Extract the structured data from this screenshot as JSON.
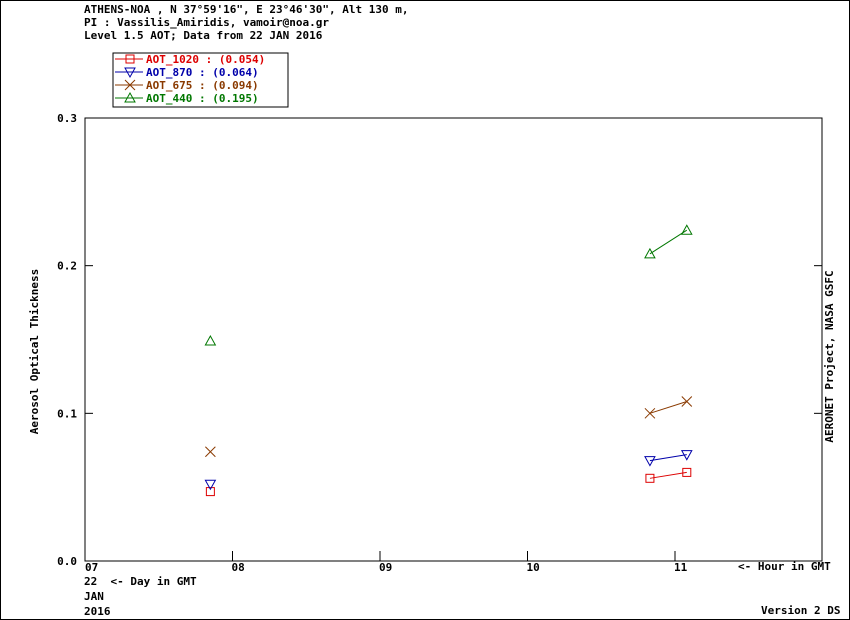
{
  "header": {
    "line1": "ATHENS-NOA , N 37°59'16\", E 23°46'30\", Alt 130 m,",
    "line2": "PI : Vassilis_Amiridis, vamoir@noa.gr",
    "line3": "Level 1.5 AOT; Data from 22 JAN 2016"
  },
  "footer": {
    "day_label": "22  <- Day in GMT",
    "month": "JAN",
    "year": "2016",
    "hour_label": "<- Hour in GMT",
    "version": "Version 2 DS",
    "credit": "AERONET Project, NASA GSFC"
  },
  "chart_data": {
    "type": "line",
    "ylabel": "Aerosol Optical Thickness",
    "xlabel": "",
    "xlim": [
      7.0,
      12.0
    ],
    "ylim": [
      0.0,
      0.3
    ],
    "x_ticks": [
      7,
      8,
      9,
      10,
      11
    ],
    "x_tick_labels": [
      "07",
      "08",
      "09",
      "10",
      "11"
    ],
    "y_ticks": [
      0.0,
      0.1,
      0.2,
      0.3
    ],
    "y_tick_labels": [
      "0.0",
      "0.1",
      "0.2",
      "0.3"
    ],
    "legend_position": "top-left",
    "series": [
      {
        "name": "AOT_1020",
        "legend_text": "AOT_1020  : (0.054)",
        "marker": "square",
        "color": "#dd0000",
        "points": [
          {
            "x": 7.85,
            "y": 0.047,
            "connected": false
          },
          {
            "x": 10.83,
            "y": 0.056,
            "connected": true
          },
          {
            "x": 11.08,
            "y": 0.06,
            "connected": true
          }
        ]
      },
      {
        "name": "AOT_870",
        "legend_text": "AOT_870  : (0.064)",
        "marker": "triangle-down",
        "color": "#0000aa",
        "points": [
          {
            "x": 7.85,
            "y": 0.052,
            "connected": false
          },
          {
            "x": 10.83,
            "y": 0.068,
            "connected": true
          },
          {
            "x": 11.08,
            "y": 0.072,
            "connected": true
          }
        ]
      },
      {
        "name": "AOT_675",
        "legend_text": "AOT_675  : (0.094)",
        "marker": "x",
        "color": "#8a3a00",
        "points": [
          {
            "x": 7.85,
            "y": 0.074,
            "connected": false
          },
          {
            "x": 10.83,
            "y": 0.1,
            "connected": true
          },
          {
            "x": 11.08,
            "y": 0.108,
            "connected": true
          }
        ]
      },
      {
        "name": "AOT_440",
        "legend_text": "AOT_440  : (0.195)",
        "marker": "triangle-up",
        "color": "#007700",
        "points": [
          {
            "x": 7.85,
            "y": 0.149,
            "connected": false
          },
          {
            "x": 10.83,
            "y": 0.208,
            "connected": true
          },
          {
            "x": 11.08,
            "y": 0.224,
            "connected": true
          }
        ]
      }
    ]
  }
}
